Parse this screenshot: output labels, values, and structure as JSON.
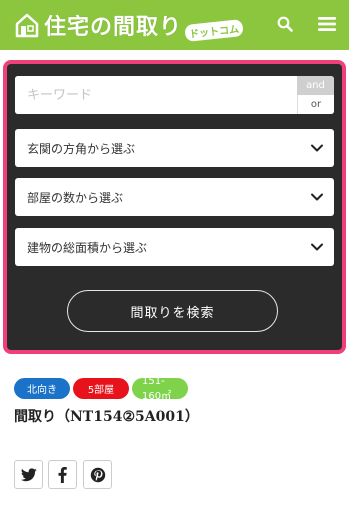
{
  "header": {
    "logo_text": "住宅の間取り",
    "logo_sub": "ドットコム",
    "colors": {
      "bar": "#8cc63f"
    }
  },
  "search": {
    "keyword_placeholder": "キーワード",
    "and_label": "and",
    "or_label": "or",
    "selects": [
      {
        "label": "玄関の方角から選ぶ"
      },
      {
        "label": "部屋の数から選ぶ"
      },
      {
        "label": "建物の総面積から選ぶ"
      }
    ],
    "submit_label": "間取りを検索",
    "colors": {
      "panel": "#2b2b2b",
      "border": "#f0407a"
    }
  },
  "tags": [
    {
      "label": "北向き",
      "color": "#1a73c8"
    },
    {
      "label": "5部屋",
      "color": "#e8121a"
    },
    {
      "label": "151-160㎡",
      "color": "#7fd34a"
    }
  ],
  "article": {
    "title": "間取り（NT154②5A001）"
  },
  "social": {
    "icons": [
      "twitter-icon",
      "facebook-icon",
      "pinterest-icon"
    ]
  }
}
